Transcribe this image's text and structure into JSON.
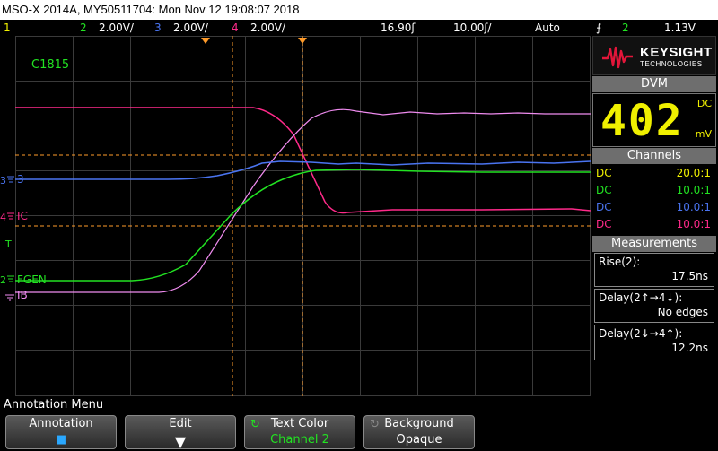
{
  "window_title": "MSO-X 2014A, MY50511704: Mon Nov 12 19:08:07 2018",
  "top_bar": {
    "ch1_num": "1",
    "ch2_num": "2",
    "ch2_scale": "2.00V/",
    "ch3_num": "3",
    "ch3_scale": "2.00V/",
    "ch4_num": "4",
    "ch4_scale": "2.00V/",
    "delay": "16.90ʃ",
    "timebase": "10.00ʃ/",
    "trigger_mode": "Auto",
    "trigger_source": "2",
    "trigger_level": "1.13V"
  },
  "colors": {
    "ch1": "#f0f000",
    "ch2": "#22e222",
    "ch3": "#4a74f0",
    "ch4": "#ff2a8a",
    "math_pink": "#f08cf0",
    "cursor": "#ff9b2a",
    "grid": "#3a3a3a"
  },
  "waveform_labels": {
    "annotation": "C1815",
    "ch3_label": "3",
    "ch4_label": "IC",
    "ch2_label": "FGEN",
    "ib_label": "IB",
    "trigger_marker": "T"
  },
  "logo": {
    "brand": "KEYSIGHT",
    "sub": "TECHNOLOGIES"
  },
  "dvm": {
    "header": "DVM",
    "value": "402",
    "coupling": "DC",
    "unit": "mV"
  },
  "channels": {
    "header": "Channels",
    "rows": [
      {
        "coupling": "DC",
        "probe": "20.0:1"
      },
      {
        "coupling": "DC",
        "probe": "10.0:1"
      },
      {
        "coupling": "DC",
        "probe": "10.0:1"
      },
      {
        "coupling": "DC",
        "probe": "10.0:1"
      }
    ]
  },
  "measurements": {
    "header": "Measurements",
    "items": [
      {
        "label": "Rise(2):",
        "value": "17.5ns"
      },
      {
        "label": "Delay(2↑→4↓):",
        "value": "No edges"
      },
      {
        "label": "Delay(2↓→4↑):",
        "value": "12.2ns"
      }
    ]
  },
  "menu": {
    "title": "Annotation Menu",
    "softkeys": [
      {
        "line1": "Annotation",
        "line2": "■"
      },
      {
        "line1": "Edit",
        "line2": "▼"
      },
      {
        "line1": "Text Color",
        "line2": "Channel 2"
      },
      {
        "line1": "Background",
        "line2": "Opaque"
      }
    ]
  }
}
